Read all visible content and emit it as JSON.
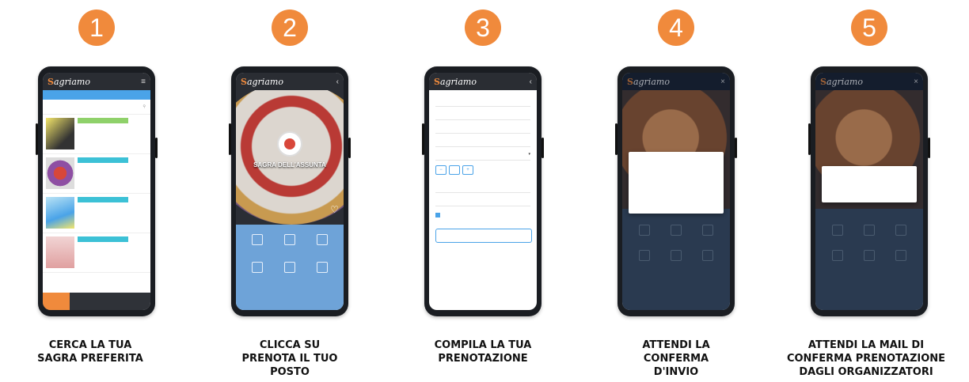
{
  "steps": [
    {
      "number": "1",
      "caption": "CERCA LA TUA\nSAGRA PREFERITA"
    },
    {
      "number": "2",
      "caption": "CLICCA SU\nPRENOTA IL TUO\nPOSTO"
    },
    {
      "number": "3",
      "caption": "COMPILA LA TUA\nPRENOTAZIONE"
    },
    {
      "number": "4",
      "caption": "ATTENDI LA\nCONFERMA\nD'INVIO"
    },
    {
      "number": "5",
      "caption": "ATTENDI LA MAIL DI\nCONFERMA PRENOTAZIONE\nDAGLI ORGANIZZATORI"
    }
  ],
  "app": {
    "logo_initial": "S",
    "logo_rest": "agriamo"
  },
  "screen2": {
    "hero_title": "SAGRA DELL'ASSUNTA"
  },
  "colors": {
    "accent": "#f08a3c",
    "brand_blue": "#4aa3e8",
    "app_bar": "#2a2d33"
  },
  "icons": [
    "menu-icon",
    "back-icon",
    "heart-icon",
    "home-icon"
  ]
}
